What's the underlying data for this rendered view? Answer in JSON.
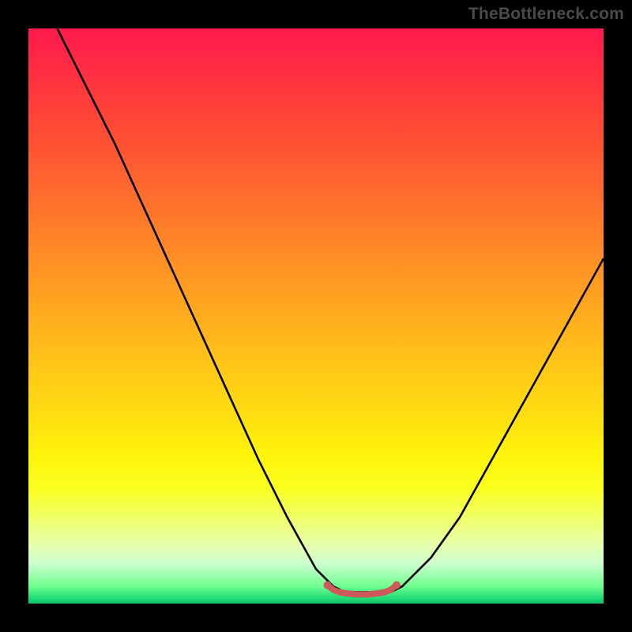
{
  "watermark": "TheBottleneck.com",
  "chart_data": {
    "type": "line",
    "title": "",
    "xlabel": "",
    "ylabel": "",
    "xlim": [
      0,
      100
    ],
    "ylim": [
      0,
      100
    ],
    "grid": false,
    "series": [
      {
        "name": "bottleneck-curve",
        "x": [
          5,
          10,
          15,
          20,
          25,
          30,
          35,
          40,
          45,
          50,
          53,
          55,
          57,
          60,
          63,
          65,
          70,
          75,
          80,
          85,
          90,
          95,
          100
        ],
        "values": [
          100,
          90,
          80,
          69,
          58,
          47,
          36,
          25,
          15,
          6,
          3,
          2,
          2,
          2,
          2,
          3,
          8,
          15,
          24,
          33,
          42,
          51,
          60
        ]
      },
      {
        "name": "flat-bottom-accent",
        "x": [
          52,
          53,
          54,
          55,
          57,
          59,
          61,
          62,
          63,
          64
        ],
        "values": [
          3.2,
          2.4,
          2.0,
          1.8,
          1.6,
          1.6,
          1.8,
          2.0,
          2.4,
          3.2
        ]
      }
    ]
  },
  "style": {
    "curve_stroke": "#000000",
    "curve_stroke_width": 2.6,
    "accent_stroke": "#cc5a5a",
    "accent_stroke_width": 8,
    "accent_dot_radius": 5
  }
}
